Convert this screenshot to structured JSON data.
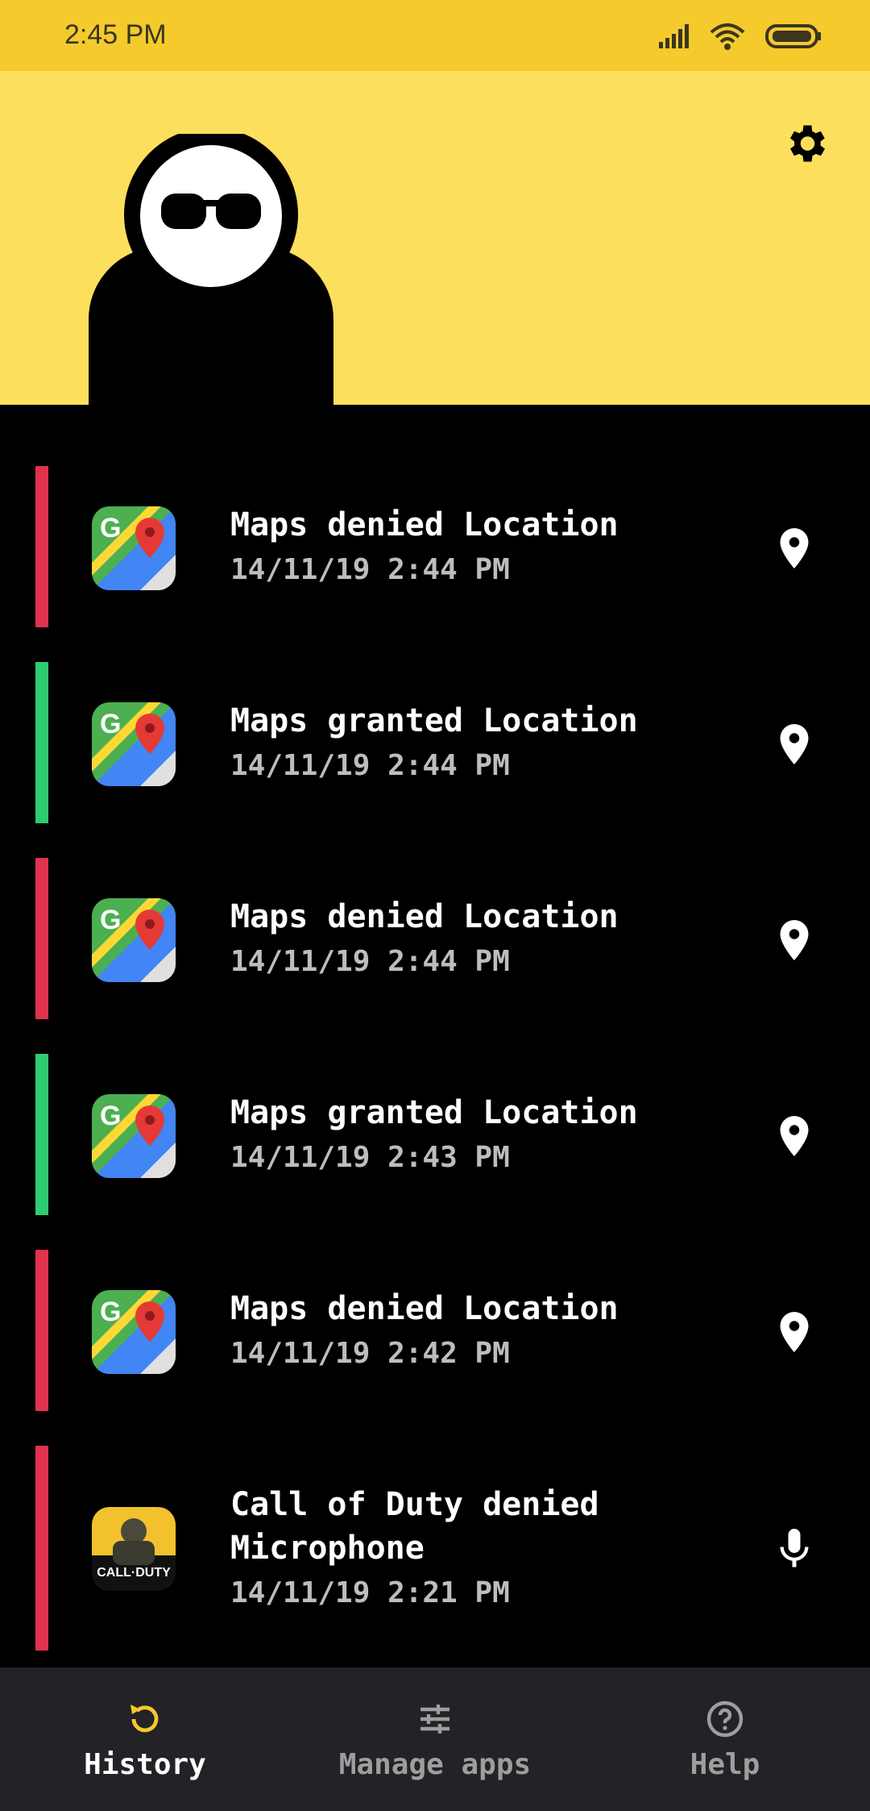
{
  "status_bar": {
    "time": "2:45 PM"
  },
  "colors": {
    "accent": "#FDDF5E",
    "status_bar": "#F4CA2C",
    "denied": "#E0324F",
    "granted": "#2ECC71",
    "nav_bg": "#232327"
  },
  "header": {
    "settings_icon": "gear-icon",
    "avatar": "incognito-character"
  },
  "history": [
    {
      "title": "Maps denied Location",
      "date": "14/11/19 2:44 PM",
      "status": "denied",
      "app_icon": "google-maps-icon",
      "permission_icon": "location-pin-icon"
    },
    {
      "title": "Maps granted Location",
      "date": "14/11/19 2:44 PM",
      "status": "granted",
      "app_icon": "google-maps-icon",
      "permission_icon": "location-pin-icon"
    },
    {
      "title": "Maps denied Location",
      "date": "14/11/19 2:44 PM",
      "status": "denied",
      "app_icon": "google-maps-icon",
      "permission_icon": "location-pin-icon"
    },
    {
      "title": "Maps granted Location",
      "date": "14/11/19 2:43 PM",
      "status": "granted",
      "app_icon": "google-maps-icon",
      "permission_icon": "location-pin-icon"
    },
    {
      "title": "Maps denied Location",
      "date": "14/11/19 2:42 PM",
      "status": "denied",
      "app_icon": "google-maps-icon",
      "permission_icon": "location-pin-icon"
    },
    {
      "title": "Call of Duty denied Microphone",
      "date": "14/11/19 2:21 PM",
      "status": "denied",
      "app_icon": "call-of-duty-icon",
      "permission_icon": "microphone-icon",
      "app_icon_text": "CALL·DUTY"
    }
  ],
  "nav": {
    "history": {
      "label": "History",
      "icon": "history-icon"
    },
    "manage": {
      "label": "Manage apps",
      "icon": "sliders-icon"
    },
    "help": {
      "label": "Help",
      "icon": "help-icon"
    }
  }
}
